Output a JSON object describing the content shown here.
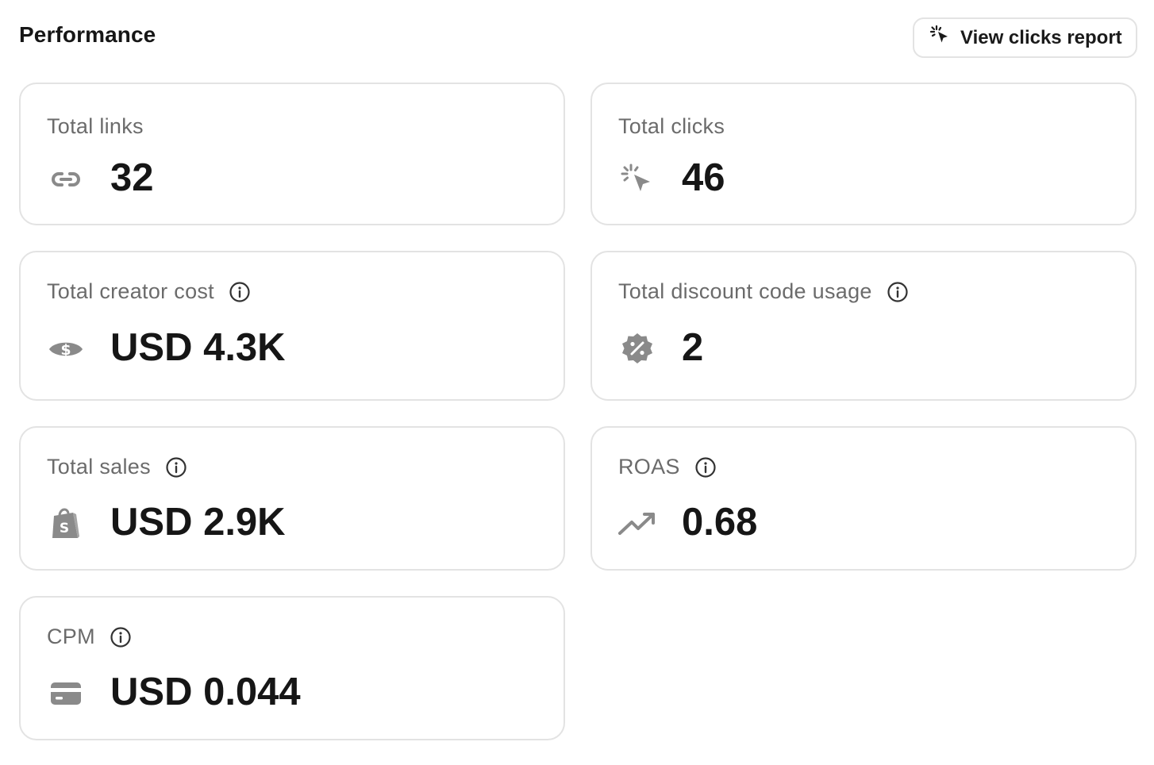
{
  "header": {
    "title": "Performance",
    "view_clicks_label": "View clicks report"
  },
  "cards": [
    {
      "label": "Total links",
      "value": "32",
      "icon": "link-icon",
      "info": false
    },
    {
      "label": "Total clicks",
      "value": "46",
      "icon": "cursor-click-icon",
      "info": false
    },
    {
      "label": "Total creator cost",
      "value": "USD 4.3K",
      "icon": "money-icon",
      "info": true
    },
    {
      "label": "Total discount code usage",
      "value": "2",
      "icon": "discount-badge-icon",
      "info": true
    },
    {
      "label": "Total sales",
      "value": "USD 2.9K",
      "icon": "shopify-bag-icon",
      "info": true
    },
    {
      "label": "ROAS",
      "value": "0.68",
      "icon": "trend-up-icon",
      "info": true
    },
    {
      "label": "CPM",
      "value": "USD 0.044",
      "icon": "card-icon",
      "info": true
    }
  ],
  "colors": {
    "border": "#e3e3e3",
    "icon": "#8a8a8a",
    "label": "#6b6b6b",
    "value": "#161616"
  }
}
